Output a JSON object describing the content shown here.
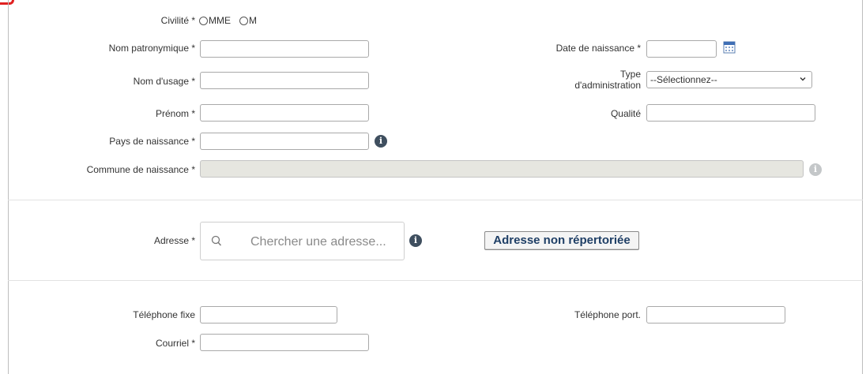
{
  "identity": {
    "civilite_label": "Civilité *",
    "civilite_options": [
      "MME",
      "M"
    ],
    "nom_patronymique_label": "Nom patronymique *",
    "nom_usage_label": "Nom d'usage *",
    "prenom_label": "Prénom *",
    "pays_naissance_label": "Pays de naissance *",
    "commune_naissance_label": "Commune de naissance *",
    "date_naissance_label": "Date de naissance *",
    "type_administration_label_line1": "Type",
    "type_administration_label_line2": "d'administration",
    "type_administration_value": "--Sélectionnez--",
    "qualite_label": "Qualité"
  },
  "address": {
    "label": "Adresse *",
    "search_placeholder": "Chercher une adresse...",
    "unlisted_button": "Adresse non répertoriée"
  },
  "contact": {
    "telephone_fixe_label": "Téléphone fixe",
    "telephone_port_label": "Téléphone port.",
    "courriel_label": "Courriel *"
  },
  "colors": {
    "accent_button_text": "#1f3f66",
    "info_icon": "#3f4f5f",
    "disabled_field": "#e6e6e0",
    "corner_mark": "#e02020"
  },
  "icons": {
    "info": "info-icon",
    "calendar": "calendar-icon",
    "search": "search-icon",
    "chevron": "chevron-down-icon"
  }
}
